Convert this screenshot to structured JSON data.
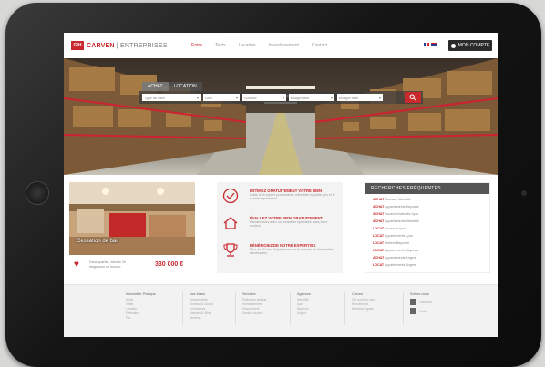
{
  "header": {
    "logo_mark": "GIH",
    "logo_brand": "CARVEN",
    "logo_suffix": "| ENTREPRISES",
    "nav": [
      "Entre",
      "Tests",
      "Location",
      "Investissement",
      "Contact"
    ],
    "account_label": "MON COMPTE",
    "colors": {
      "accent": "#c8292c",
      "dark": "#2b2b2b"
    }
  },
  "search": {
    "tabs": [
      "ACHAT",
      "LOCATION"
    ],
    "fields": [
      "Type de bien",
      "Lieu",
      "Surface",
      "Budget min",
      "Budget max"
    ],
    "button_icon": "search-icon"
  },
  "featured": {
    "caption": "Cessation de bail",
    "description": "Dans quartier, dans le 2e étage pour un bureau",
    "price": "330 000 €",
    "icon": "heart-icon"
  },
  "services": [
    {
      "title": "ESTIMEZ GRATUITEMENT VOTRE BIEN",
      "text": "L'avis d'un expert pour estimer votre bien au juste prix et le vendre rapidement.",
      "icon": "check-circle-icon"
    },
    {
      "title": "ÉVALUEZ VOTRE BIEN GRATUITEMENT",
      "text": "Rendez-vous avec un conseiller spécialisé dans votre secteur.",
      "icon": "home-icon"
    },
    {
      "title": "BÉNÉFICIEZ DE NOTRE EXPERTISE",
      "text": "Plus de 20 ans d'expérience sur le marché de l'immobilier d'entreprise.",
      "icon": "trophy-icon"
    }
  ],
  "frequent_searches": {
    "title": "RECHERCHES FRÉQUENTES",
    "items": [
      {
        "tag": "ACHAT",
        "text": "Bureaux Marseille"
      },
      {
        "tag": "ACHAT",
        "text": "Appartements Bayonne"
      },
      {
        "tag": "ACHAT",
        "text": "Locaux d'activités Lyon"
      },
      {
        "tag": "ACHAT",
        "text": "Appartements Marseille"
      },
      {
        "tag": "LOCAT",
        "text": "Locaux à Lyon"
      },
      {
        "tag": "LOCAT",
        "text": "Appartements Lyon"
      },
      {
        "tag": "LOCAT",
        "text": "Ateliers Bayonne"
      },
      {
        "tag": "LOCAT",
        "text": "Appartements Bayonne"
      },
      {
        "tag": "ACHAT",
        "text": "Appartements Angers"
      },
      {
        "tag": "LOCAT",
        "text": "Appartements Angers"
      }
    ]
  },
  "footer": {
    "columns": [
      {
        "title": "Immobilier Pratique",
        "items": [
          "Achat",
          "Vente",
          "Location",
          "Estimation",
          "Prix"
        ]
      },
      {
        "title": "Nos biens",
        "items": [
          "Appartements",
          "Bureaux & Locaux",
          "Commerces",
          "Maisons & Villas",
          "Terrains"
        ]
      },
      {
        "title": "Services",
        "items": [
          "Estimation gratuite",
          "Investissement",
          "Financement",
          "Gestion locative"
        ]
      },
      {
        "title": "Agences",
        "items": [
          "Marseille",
          "Lyon",
          "Bayonne",
          "Angers"
        ]
      },
      {
        "title": "Carven",
        "items": [
          "Qui sommes-nous",
          "Recrutement",
          "Mentions légales"
        ]
      }
    ],
    "social_title": "Suivez-nous",
    "social": [
      {
        "icon": "facebook-icon",
        "label": "Facebook"
      },
      {
        "icon": "twitter-icon",
        "label": "Twitter"
      }
    ]
  }
}
